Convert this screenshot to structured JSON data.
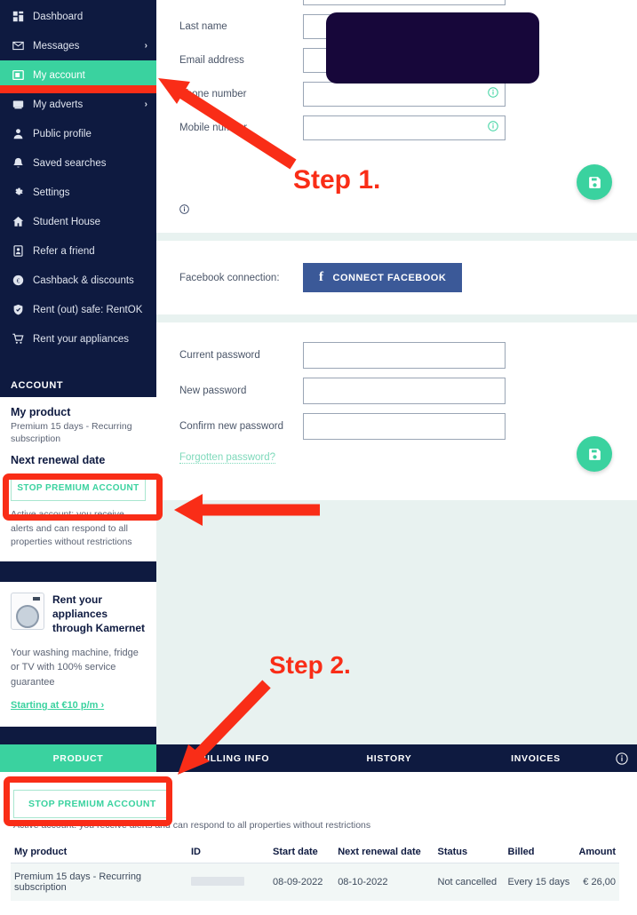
{
  "colors": {
    "navy": "#0e1a40",
    "green": "#3ad29f",
    "facebook_blue": "#3b5998",
    "annotation_red": "#f92d17",
    "page_bg": "#e8f2f0"
  },
  "sidebar": {
    "nav": [
      {
        "label": "Dashboard",
        "icon": "dashboard-grid-icon",
        "chevron": "",
        "active": false
      },
      {
        "label": "Messages",
        "icon": "envelope-icon",
        "chevron": "›",
        "active": false
      },
      {
        "label": "My account",
        "icon": "account-card-icon",
        "chevron": "",
        "active": true
      },
      {
        "label": "My adverts",
        "icon": "advert-board-icon",
        "chevron": "›",
        "active": false
      },
      {
        "label": "Public profile",
        "icon": "person-icon",
        "chevron": "",
        "active": false
      },
      {
        "label": "Saved searches",
        "icon": "bell-icon",
        "chevron": "",
        "active": false
      },
      {
        "label": "Settings",
        "icon": "gear-icon",
        "chevron": "",
        "active": false
      },
      {
        "label": "Student House",
        "icon": "home-icon",
        "chevron": "",
        "active": false
      },
      {
        "label": "Refer a friend",
        "icon": "id-card-icon",
        "chevron": "",
        "active": false
      },
      {
        "label": "Cashback & discounts",
        "icon": "euro-coin-icon",
        "chevron": "",
        "active": false
      },
      {
        "label": "Rent (out) safe: RentOK",
        "icon": "shield-check-icon",
        "chevron": "",
        "active": false
      },
      {
        "label": "Rent your appliances",
        "icon": "shopping-cart-icon",
        "chevron": "",
        "active": false
      }
    ],
    "account_card": {
      "header": "ACCOUNT",
      "product_heading": "My product",
      "product_value": "Premium 15 days - Recurring subscription",
      "renewal_heading": "Next renewal date",
      "renewal_value": "",
      "stop_button": "STOP PREMIUM ACCOUNT",
      "status_note": "Active account: you receive alerts and can respond to all properties without restrictions"
    },
    "appliance_card": {
      "title": "Rent your appliances through Kamernet",
      "description": "Your washing machine, fridge or TV with 100% service guarantee",
      "link": "Starting at €10 p/m ›",
      "icon": "washing-machine-icon"
    }
  },
  "profile_form": {
    "fields": [
      {
        "label": "Last name",
        "value": "",
        "info": false
      },
      {
        "label": "Email address",
        "value": "",
        "info": false
      },
      {
        "label": "Phone number",
        "value": "",
        "info": true
      },
      {
        "label": "Mobile number",
        "value": "",
        "info": true
      }
    ],
    "redacted": true,
    "footer_info_icon": "info-circle-icon",
    "save_icon": "save-floppy-icon"
  },
  "facebook": {
    "label": "Facebook connection:",
    "button": "CONNECT FACEBOOK",
    "icon": "facebook-f-icon"
  },
  "password_form": {
    "fields": [
      {
        "label": "Current password",
        "value": ""
      },
      {
        "label": "New password",
        "value": ""
      },
      {
        "label": "Confirm new password",
        "value": ""
      }
    ],
    "forgot_link": "Forgotten password?",
    "save_icon": "save-floppy-icon"
  },
  "tabs": {
    "items": [
      {
        "label": "PRODUCT",
        "active": true
      },
      {
        "label": "BILLING INFO",
        "active": false
      },
      {
        "label": "HISTORY",
        "active": false
      },
      {
        "label": "INVOICES",
        "active": false
      }
    ],
    "info_icon": "info-circle-icon"
  },
  "product_panel": {
    "stop_button": "STOP PREMIUM ACCOUNT",
    "status_note": "Active account: you receive alerts and can respond to all properties without restrictions",
    "table": {
      "headers": [
        "My product",
        "ID",
        "Start date",
        "Next renewal date",
        "Status",
        "Billed",
        "Amount"
      ],
      "rows": [
        {
          "product": "Premium 15 days - Recurring subscription",
          "id": "",
          "start_date": "08-09-2022",
          "next_renewal_date": "08-10-2022",
          "status": "Not cancelled",
          "billed": "Every 15 days",
          "amount": "€ 26,00"
        }
      ]
    }
  },
  "annotations": {
    "step1": "Step 1.",
    "step2": "Step 2."
  }
}
